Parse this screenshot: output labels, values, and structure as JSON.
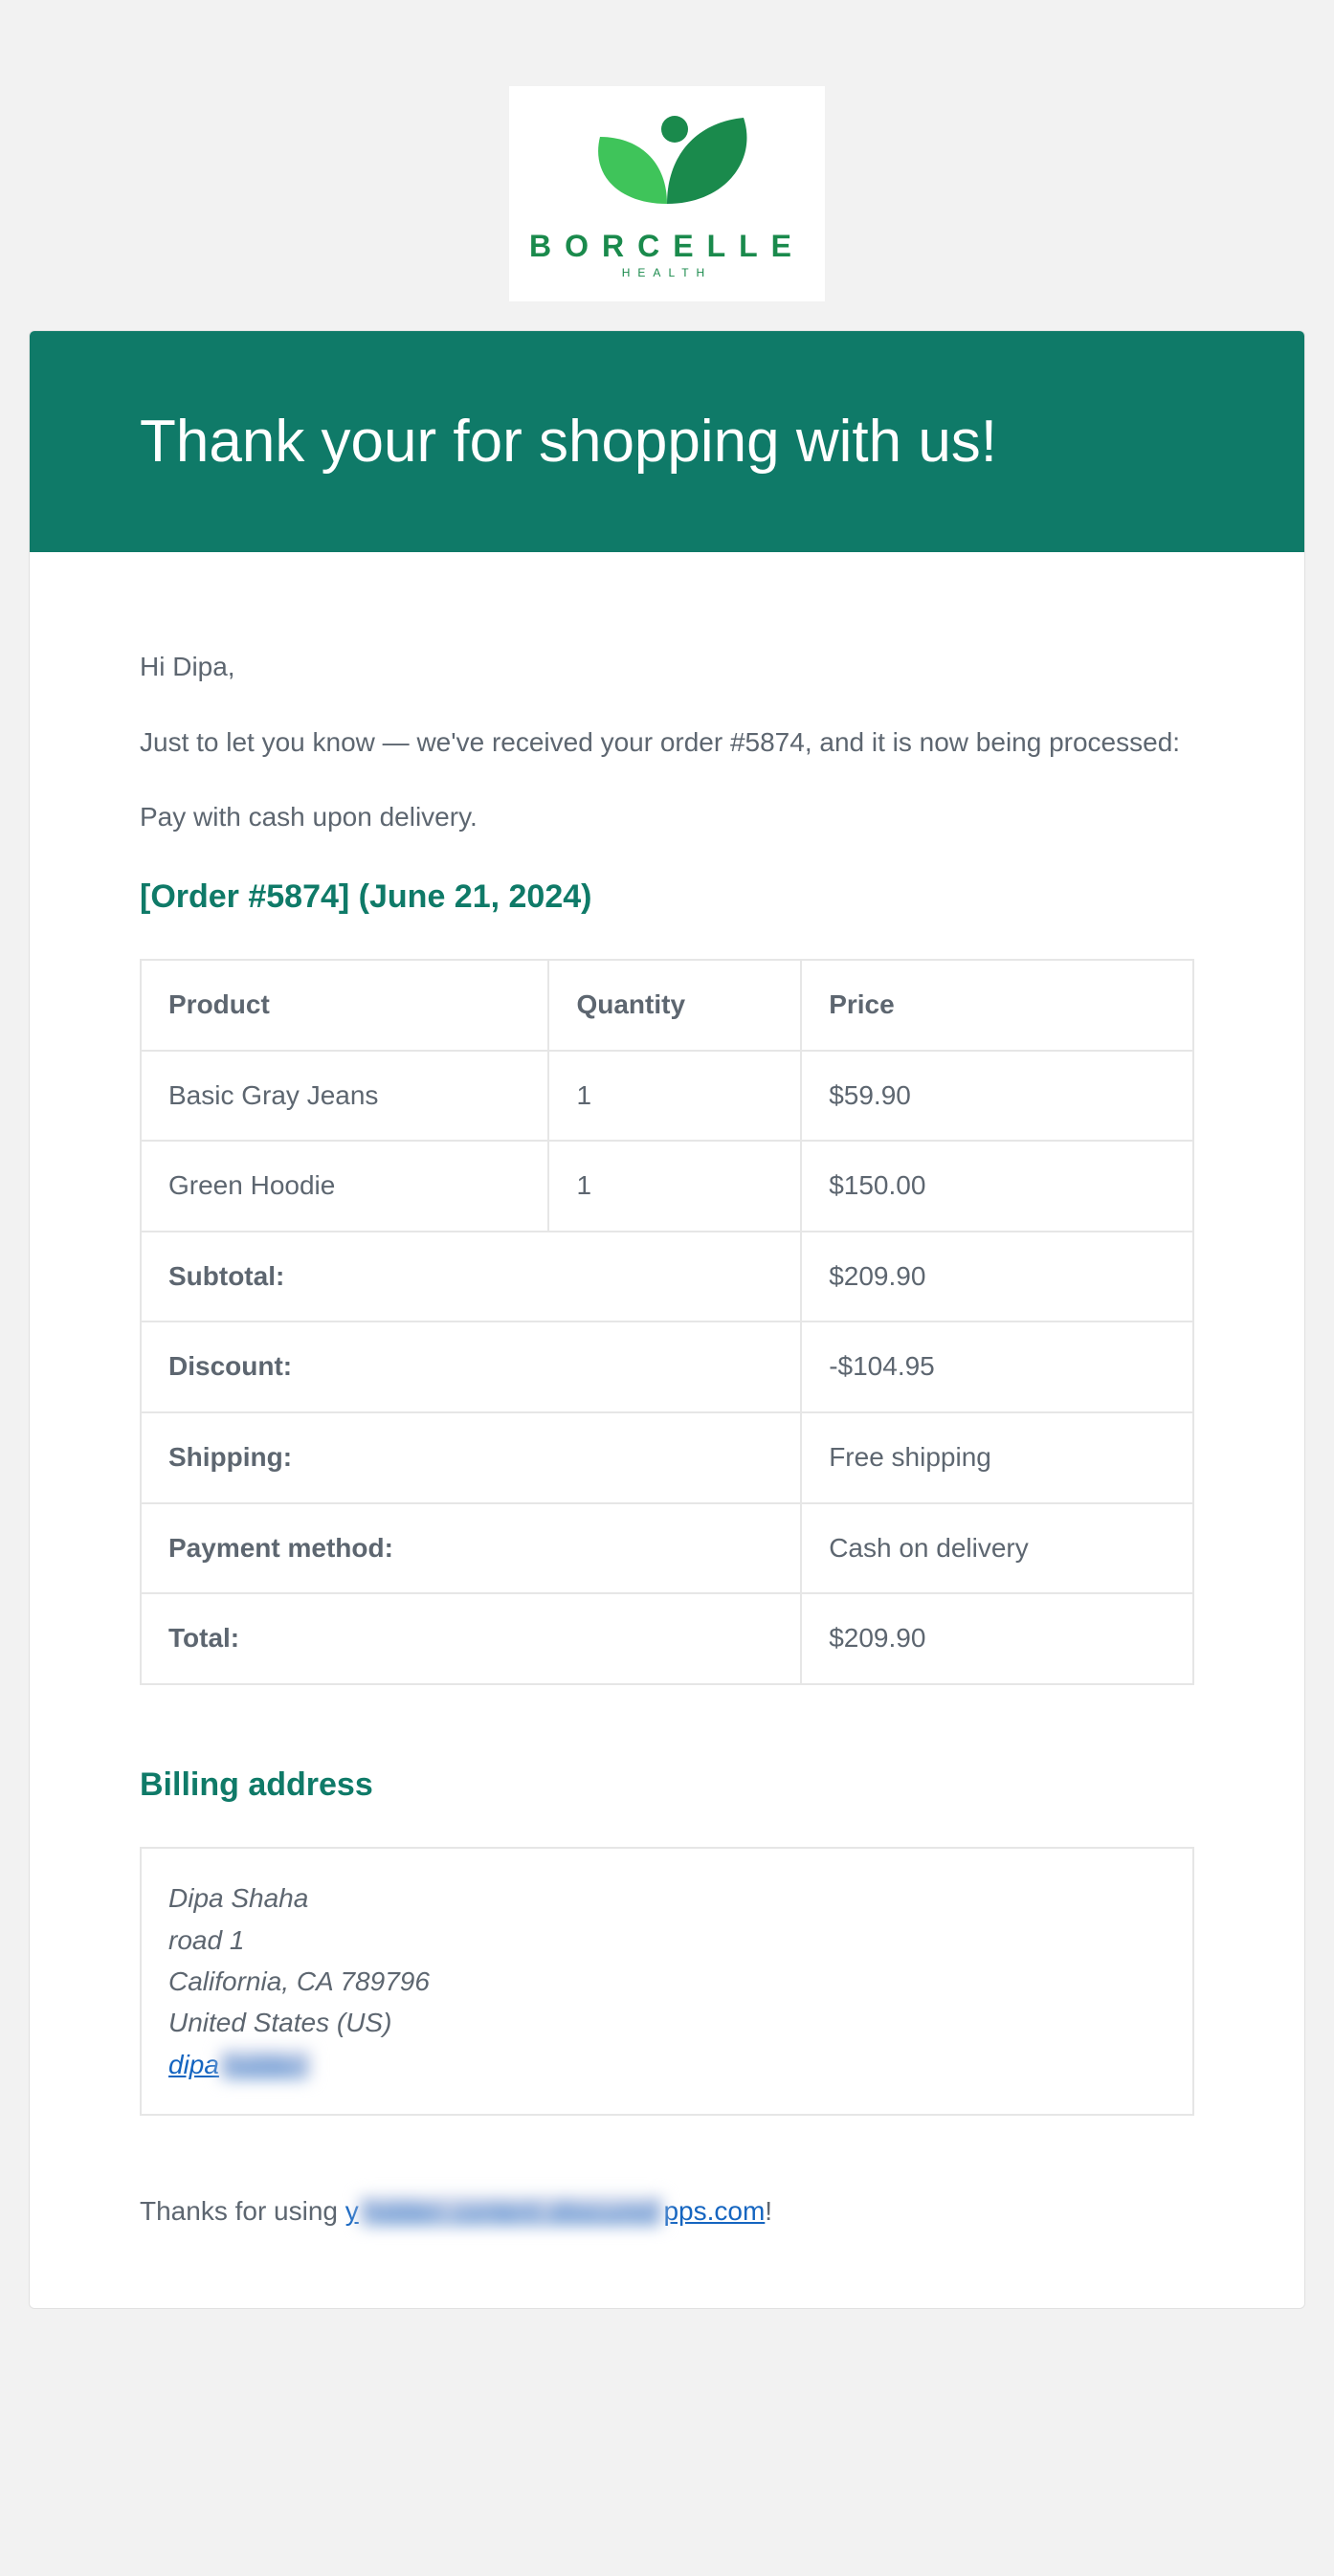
{
  "brand": {
    "name": "BORCELLE",
    "sub": "HEALTH"
  },
  "banner": {
    "title": "Thank your for shopping with us!"
  },
  "greeting": "Hi Dipa,",
  "intro": "Just to let you know — we've received your order #5874, and it is now being processed:",
  "payNote": "Pay with cash upon delivery.",
  "orderHeading": "[Order #5874] (June 21, 2024)",
  "table": {
    "headers": {
      "product": "Product",
      "qty": "Quantity",
      "price": "Price"
    },
    "items": [
      {
        "product": "Basic Gray Jeans",
        "qty": "1",
        "price": "$59.90"
      },
      {
        "product": "Green Hoodie",
        "qty": "1",
        "price": "$150.00"
      }
    ],
    "totals": [
      {
        "label": "Subtotal:",
        "value": "$209.90"
      },
      {
        "label": "Discount:",
        "value": "-$104.95"
      },
      {
        "label": "Shipping:",
        "value": "Free shipping"
      },
      {
        "label": "Payment method:",
        "value": "Cash on delivery"
      },
      {
        "label": "Total:",
        "value": "$209.90"
      }
    ]
  },
  "billingHeading": "Billing address",
  "billing": {
    "name": "Dipa Shaha",
    "line1": "road 1",
    "line2": "California, CA 789796",
    "country": "United States (US)",
    "emailVisible": "dipa",
    "emailHidden": "hidden"
  },
  "thanks": {
    "prefix": "Thanks for using ",
    "linkStart": "y",
    "hidden": "hidden content obscured",
    "suffix": "pps.com",
    "end": "!"
  }
}
